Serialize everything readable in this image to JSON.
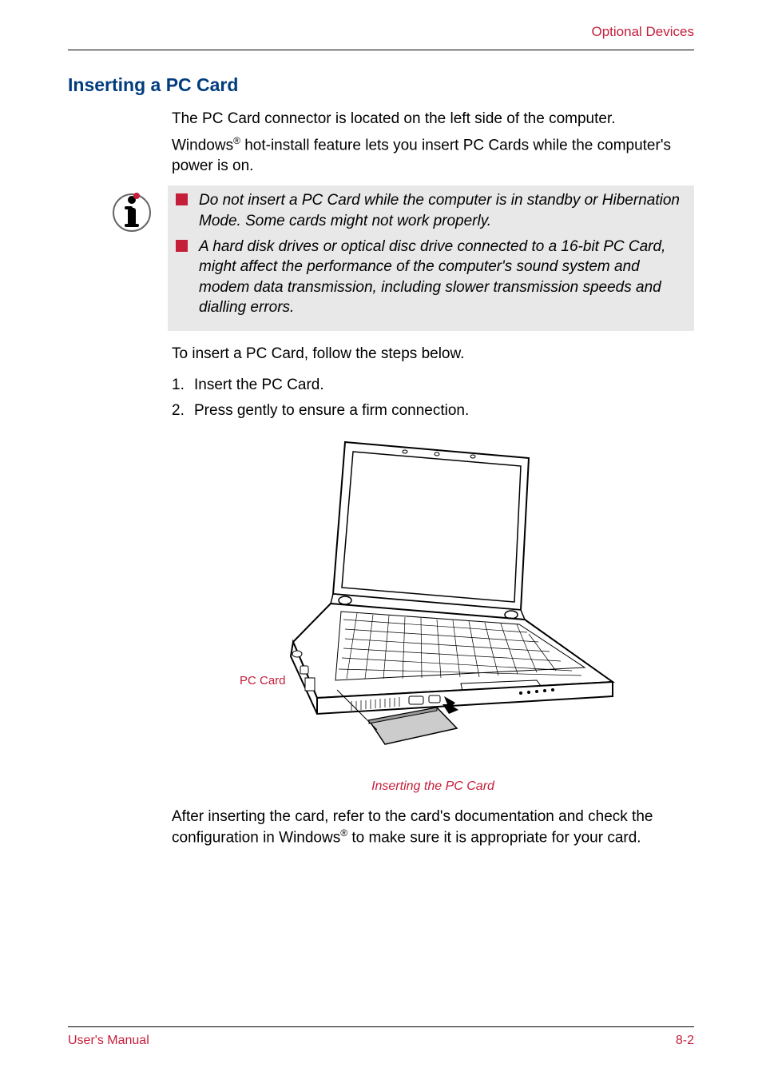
{
  "header": {
    "link": "Optional Devices"
  },
  "section": {
    "heading": "Inserting a PC Card",
    "intro1": "The PC Card connector is located on the left side of the computer.",
    "intro2a": "Windows",
    "intro2_sup": "®",
    "intro2b": " hot-install feature lets you insert PC Cards while the computer's power is on."
  },
  "notes": {
    "item1": "Do not insert a PC Card while the computer is in standby or Hibernation Mode. Some cards might not work properly.",
    "item2": "A hard disk drives or optical disc drive connected to a 16-bit PC Card, might affect the performance of the computer's sound system and modem data transmission, including slower transmission speeds and dialling errors."
  },
  "steps": {
    "intro": "To insert a PC Card, follow the steps below.",
    "step1_num": "1.",
    "step1_text": "Insert the PC Card.",
    "step2_num": "2.",
    "step2_text": "Press gently to ensure a firm connection."
  },
  "figure": {
    "label": "PC Card",
    "caption": "Inserting the PC Card"
  },
  "after": {
    "text1a": "After inserting the card, refer to the card's documentation and check the configuration in Windows",
    "text1_sup": "®",
    "text1b": " to make sure it is appropriate for your card."
  },
  "footer": {
    "left": "User's Manual",
    "right": "8-2"
  }
}
